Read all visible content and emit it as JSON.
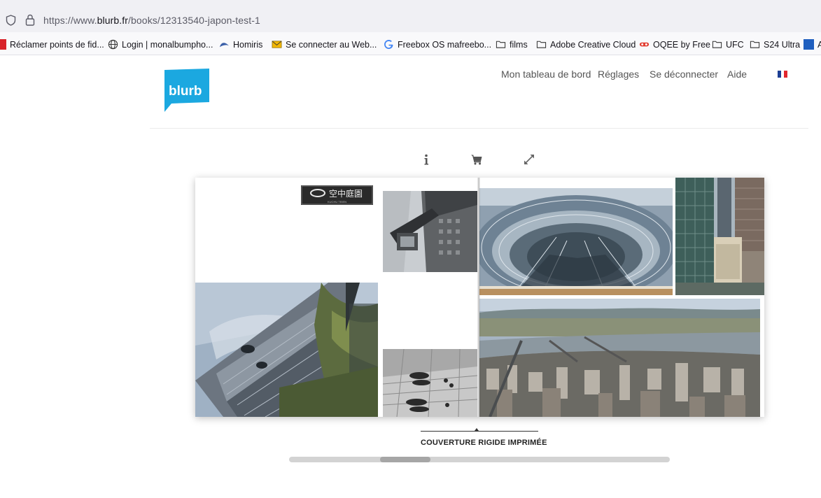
{
  "browser": {
    "url_prefix": "https://www.",
    "url_domain": "blurb.fr",
    "url_path": "/books/12313540-japon-test-1"
  },
  "bookmarks": [
    {
      "label": "Réclamer points de fid...",
      "icon": "bookmark-favicon-red"
    },
    {
      "label": "Login | monalbumpho...",
      "icon": "globe-icon"
    },
    {
      "label": "Homiris",
      "icon": "homiris-icon"
    },
    {
      "label": "Se connecter au Web...",
      "icon": "mail-icon"
    },
    {
      "label": "Freebox OS  mafreebo...",
      "icon": "google-icon"
    },
    {
      "label": "films",
      "icon": "folder-icon"
    },
    {
      "label": "Adobe Creative Cloud",
      "icon": "folder-icon"
    },
    {
      "label": "OQEE by Free",
      "icon": "oqee-icon"
    },
    {
      "label": "UFC",
      "icon": "folder-icon"
    },
    {
      "label": "S24 Ultra",
      "icon": "folder-icon"
    },
    {
      "label": "A",
      "icon": "bookmark-favicon-blue"
    }
  ],
  "site": {
    "logo_text": "blurb",
    "brand_color": "#1BA8E0",
    "nav": {
      "dashboard": "Mon tableau de bord",
      "settings": "Réglages",
      "logout": "Se déconnecter",
      "help": "Aide"
    },
    "language_flag": "fr-flag-icon"
  },
  "toolbar": {
    "icons": [
      "info-icon",
      "cart-icon",
      "expand-icon"
    ]
  },
  "book": {
    "sign_text": "空中庭園",
    "sign_subtext": "KUCHU TEIEN"
  },
  "cover": {
    "label": "COUVERTURE RIGIDE IMPRIMÉE"
  },
  "scrollbar": {
    "position_fraction": 0.28
  }
}
